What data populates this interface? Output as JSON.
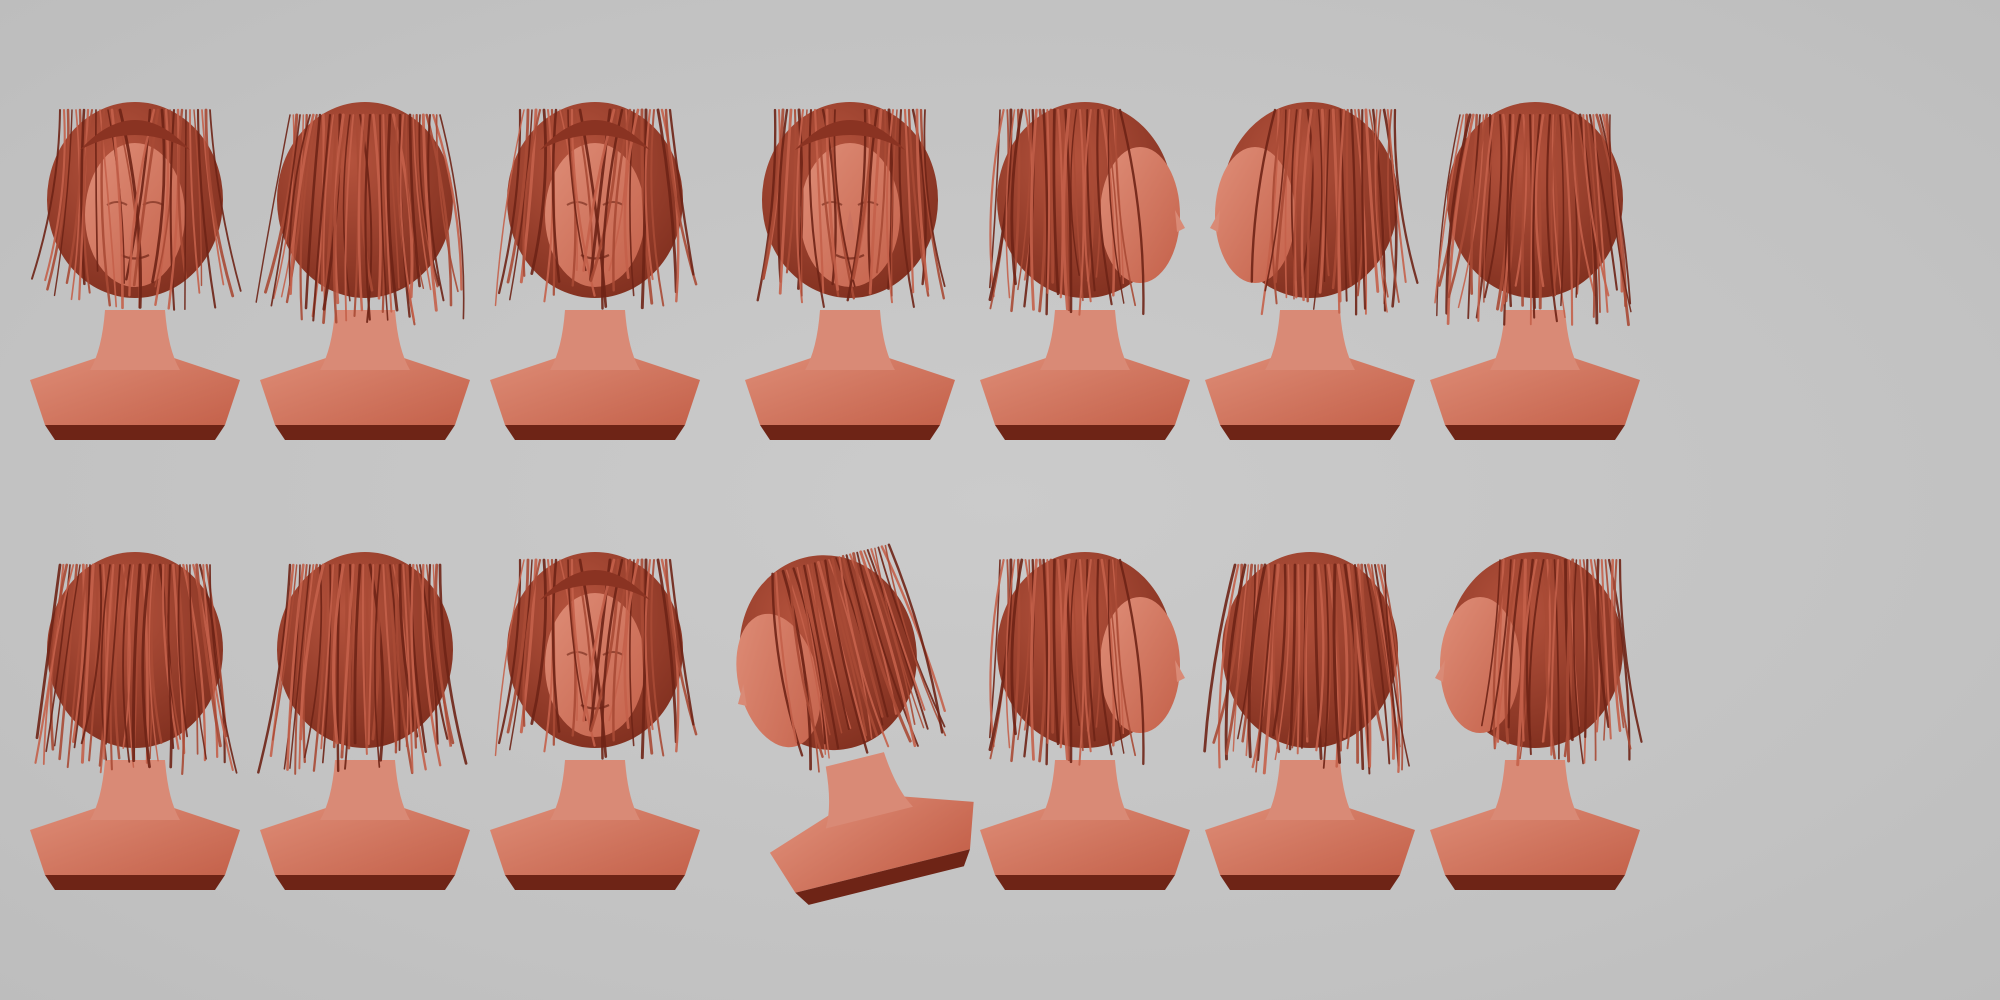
{
  "scene": {
    "background_color": "#c4c4c4",
    "clay_color": "#c4614a",
    "clay_shadow_color": "#6e2416",
    "clay_highlight_color": "#df8e78",
    "skin_color": "#d98a76",
    "rows": [
      {
        "views": [
          {
            "view": "front",
            "tilt": 0
          },
          {
            "view": "back-left",
            "tilt": 0
          },
          {
            "view": "front",
            "tilt": 0
          },
          {
            "view": "front",
            "tilt": 0
          },
          {
            "view": "right",
            "tilt": 0
          },
          {
            "view": "left-3q",
            "tilt": 0
          },
          {
            "view": "back-right",
            "tilt": 0
          }
        ]
      },
      {
        "views": [
          {
            "view": "back-left",
            "tilt": 0
          },
          {
            "view": "back",
            "tilt": 0
          },
          {
            "view": "front-down",
            "tilt": 0
          },
          {
            "view": "left-down",
            "tilt": -14
          },
          {
            "view": "right",
            "tilt": 0
          },
          {
            "view": "back-right",
            "tilt": 0
          },
          {
            "view": "left",
            "tilt": 0
          }
        ]
      }
    ]
  }
}
